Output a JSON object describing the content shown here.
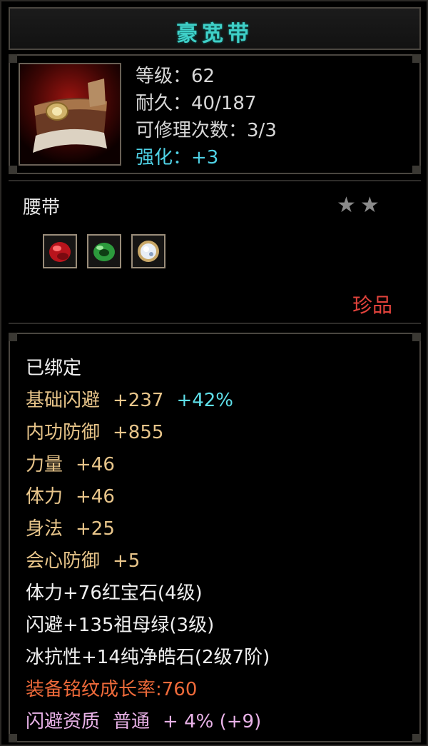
{
  "title": "豪宽带",
  "item": {
    "level_label": "等级：",
    "level_value": "62",
    "durability_label": "耐久：",
    "durability_value": "40/187",
    "repair_label": "可修理次数：",
    "repair_value": "3/3",
    "enhance_label": "强化：",
    "enhance_value": "+3",
    "type": "腰带",
    "stars": "★★",
    "rarity": "珍品",
    "gems": [
      "red-ruby-gem-icon",
      "green-emerald-gem-icon",
      "white-diamond-gem-icon"
    ]
  },
  "attributes": {
    "bound": "已绑定",
    "dodge_label": "基础闪避",
    "dodge_value": "+237",
    "dodge_pct": "+42%",
    "inner_def_label": "内功防御",
    "inner_def_value": "+855",
    "strength_label": "力量",
    "strength_value": "+46",
    "stamina_label": "体力",
    "stamina_value": "+46",
    "agility_label": "身法",
    "agility_value": "+25",
    "crit_def_label": "会心防御",
    "crit_def_value": "+5",
    "gem1": "体力+76红宝石(4级)",
    "gem2": "闪避+135祖母绿(3级)",
    "gem3": "冰抗性+14纯净皓石(2级7阶)",
    "inscription": "装备铭纹成长率:760",
    "aptitude_label": "闪避资质",
    "aptitude_grade": "普通",
    "aptitude_bonus": "+ 4% (+9)"
  },
  "colors": {
    "title": "#3fd0c8",
    "enhance": "#4fd2e6",
    "rarity": "#e2433c",
    "attribute": "#e8c58a",
    "inscription": "#ee6a3a",
    "aptitude": "#e9b2e8"
  }
}
